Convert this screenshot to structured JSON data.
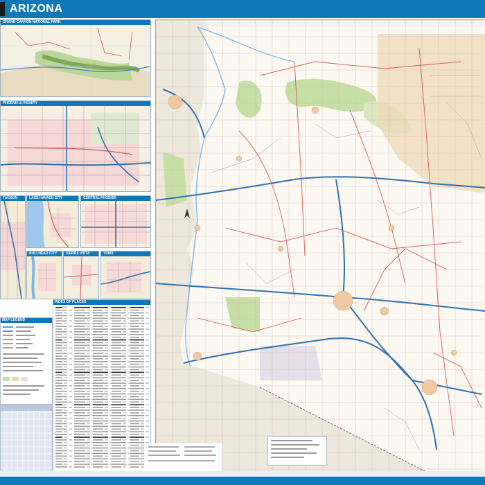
{
  "header": {
    "title": "ARIZONA"
  },
  "insets": {
    "grand_canyon": "GRAND CANYON NATIONAL PARK",
    "phoenix_vicinity": "PHOENIX & VICINITY",
    "tucson": "TUCSON",
    "lake_havasu": "LAKE HAVASU CITY",
    "central_phoenix": "CENTRAL PHOENIX",
    "bullhead": "BULLHEAD CITY",
    "sierra_vista": "SIERRA VISTA",
    "yuma": "YUMA"
  },
  "panels": {
    "index_title": "INDEX OF PLACES",
    "legend_title": "MAP LEGEND"
  },
  "colors": {
    "header_blue": "#1178b8",
    "land": "#f6f3ea",
    "park_green": "#c6dfa6",
    "reservation_tan": "#ecd9b4",
    "highway_blue": "#2f6fb0",
    "road_red": "#d25a55"
  }
}
